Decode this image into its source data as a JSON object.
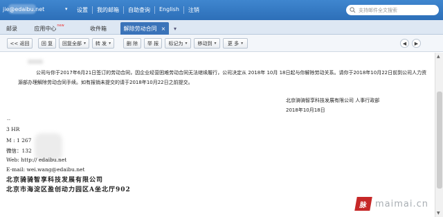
{
  "topbar": {
    "email": "jie@edaibu.net",
    "dropdown_arrow": "▾",
    "links": [
      "设置",
      "我的邮箱",
      "自助查询",
      "English",
      "注销"
    ],
    "search_placeholder": "支持邮件全文搜索"
  },
  "tabs": [
    {
      "label": "邮录"
    },
    {
      "label": "应用中心",
      "badge": "new"
    },
    {
      "label": "收件箱"
    },
    {
      "label": "解除劳动合同",
      "close": "×"
    }
  ],
  "tab_overflow": "▾",
  "toolbar": {
    "back": "<< 返回",
    "reply": "回 复",
    "reply_all": "回复全部",
    "forward": "转 发",
    "delete": "删 除",
    "report": "举 报",
    "mark_as": "标记为",
    "move_to": "移动到",
    "more": "更 多",
    "dropdown_arrow": "▾",
    "prev": "◀",
    "next": "▶"
  },
  "message": {
    "paragraph": "公司与你于2017年6月21日签订的劳动合同，因企业经营困难劳动合同无法继续履行，公司决定从 2018年 10月 18日起与你解除劳动关系。请你于2018年10月22日前到公司人力资源部办理解除劳动合同手续。如有报销未提交的请于2018年10月22日之前提交。",
    "sig_company": "北京骑骑智享科技发展有限公司   人事行政部",
    "sig_date": "2018年10月18日",
    "dashes": "--"
  },
  "card": {
    "line1": "3    HR",
    "line2": "M   :  1     267",
    "line3": "微信：132",
    "line4": "Web:  http://    edaibu.net",
    "line5": "E-mail:  wei.wang@edaibu.net",
    "line6": "北京骑骑智享科技发展有限公司",
    "line7": "北京市海淀区盈创动力园区A坐北厅902"
  },
  "watermark": {
    "logo": "脉",
    "text": "maimai.cn"
  },
  "colors": {
    "topbar": "#2d6fb8",
    "active_tab": "#3a73b9"
  }
}
